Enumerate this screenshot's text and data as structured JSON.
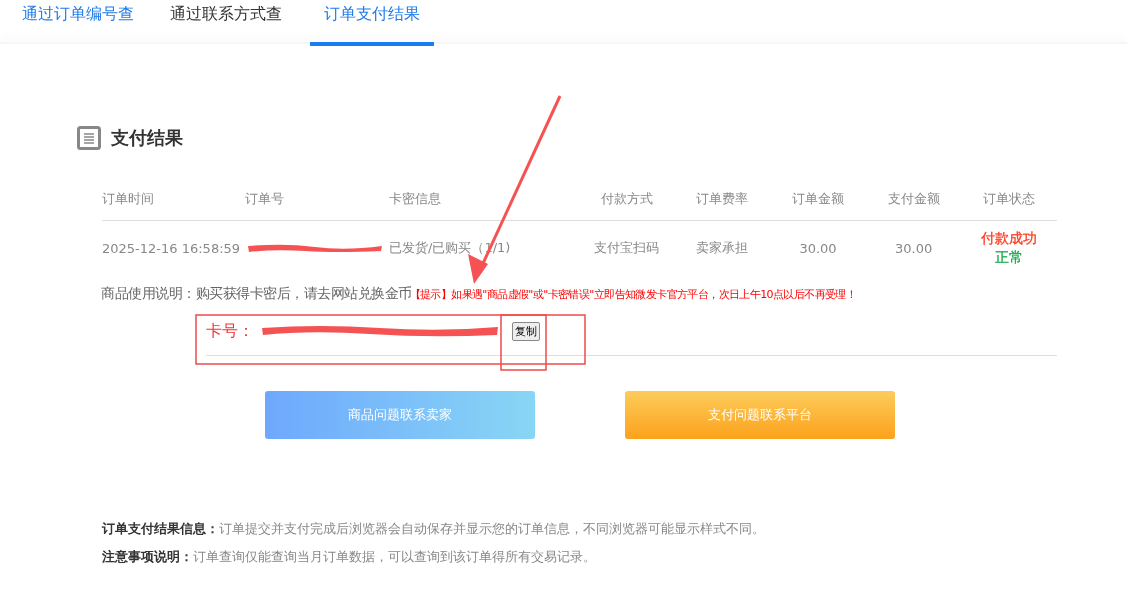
{
  "tabs": [
    {
      "label": "通过订单编号查",
      "selected": false,
      "link": true
    },
    {
      "label": "通过联系方式查",
      "selected": false,
      "link": false
    },
    {
      "label": "订单支付结果",
      "selected": true,
      "link": true
    }
  ],
  "section": {
    "title": "支付结果"
  },
  "table": {
    "columns": [
      {
        "label": "订单时间"
      },
      {
        "label": "订单号"
      },
      {
        "label": "卡密信息"
      },
      {
        "label": "付款方式"
      },
      {
        "label": "订单费率"
      },
      {
        "label": "订单金额"
      },
      {
        "label": "支付金额"
      },
      {
        "label": "订单状态"
      }
    ],
    "rows": [
      {
        "cells": [
          {
            "kind": "text",
            "lines": [
              {
                "text": "2025-12-16 16:58:59"
              }
            ]
          },
          {
            "kind": "redacted"
          },
          {
            "kind": "text",
            "lines": [
              {
                "text": "已发货/已购买（1/1)"
              }
            ]
          },
          {
            "kind": "text",
            "lines": [
              {
                "text": "支付宝扫码"
              }
            ]
          },
          {
            "kind": "text",
            "lines": [
              {
                "text": "卖家承担"
              }
            ]
          },
          {
            "kind": "text",
            "lines": [
              {
                "text": "30.00"
              }
            ]
          },
          {
            "kind": "text",
            "lines": [
              {
                "text": "30.00"
              }
            ]
          },
          {
            "kind": "status",
            "lines": [
              {
                "text": "付款成功",
                "color": "#ff3b1f"
              },
              {
                "text": "正常",
                "color": "#13a94a"
              }
            ]
          }
        ]
      }
    ]
  },
  "usage": {
    "text": "商品使用说明：购买获得卡密后，请去网站兑换金币",
    "tip": "【提示】如果遇\"商品虚假\"或\"卡密错误\"立即告知微发卡官方平台，次日上午10点以后不再受理！"
  },
  "card": {
    "label": "卡号：",
    "redacted": true,
    "copy_button": "复制"
  },
  "buttons": [
    {
      "label": "商品问题联系卖家",
      "kind": "blue"
    },
    {
      "label": "支付问题联系平台",
      "kind": "orange"
    }
  ],
  "notes": [
    {
      "label": "订单支付结果信息：",
      "text": "订单提交并支付完成后浏览器会自动保存并显示您的订单信息，不同浏览器可能显示样式不同。"
    },
    {
      "label": "注意事项说明：",
      "text": "订单查询仅能查询当月订单数据，可以查询到该订单得所有交易记录。"
    }
  ]
}
